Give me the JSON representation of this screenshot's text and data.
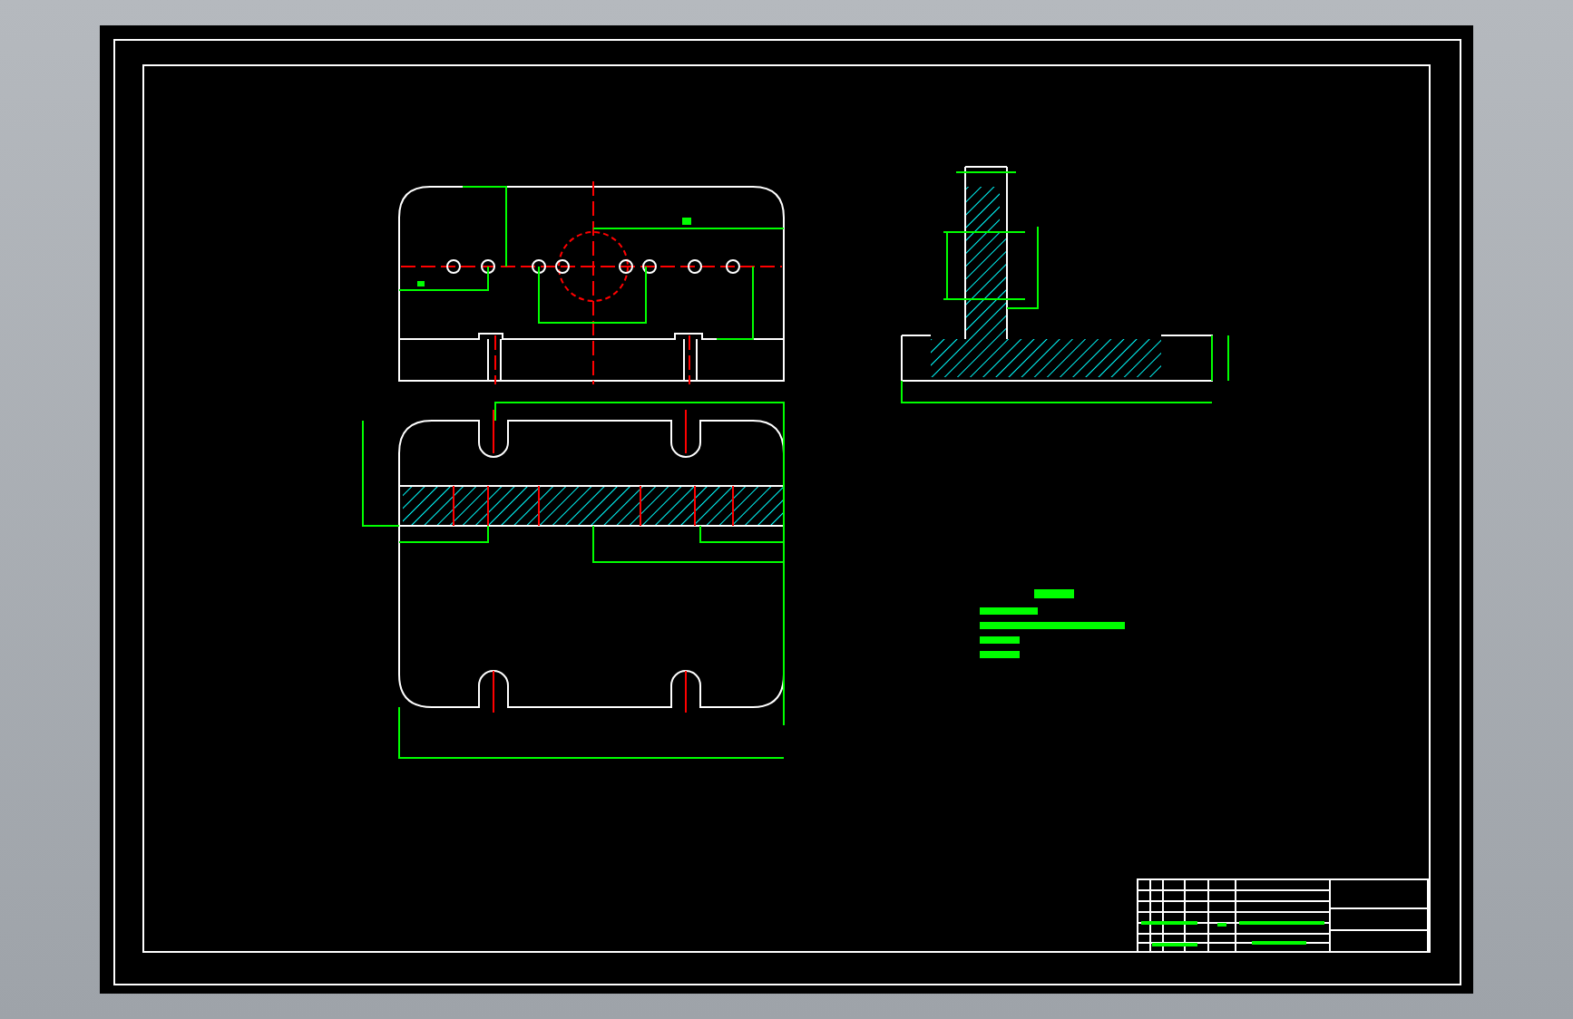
{
  "drawing": {
    "parts": [
      {
        "kind": "front"
      },
      {
        "kind": "plan"
      },
      {
        "kind": "section"
      },
      {
        "kind": "notes"
      },
      {
        "kind": "title_block"
      }
    ]
  }
}
